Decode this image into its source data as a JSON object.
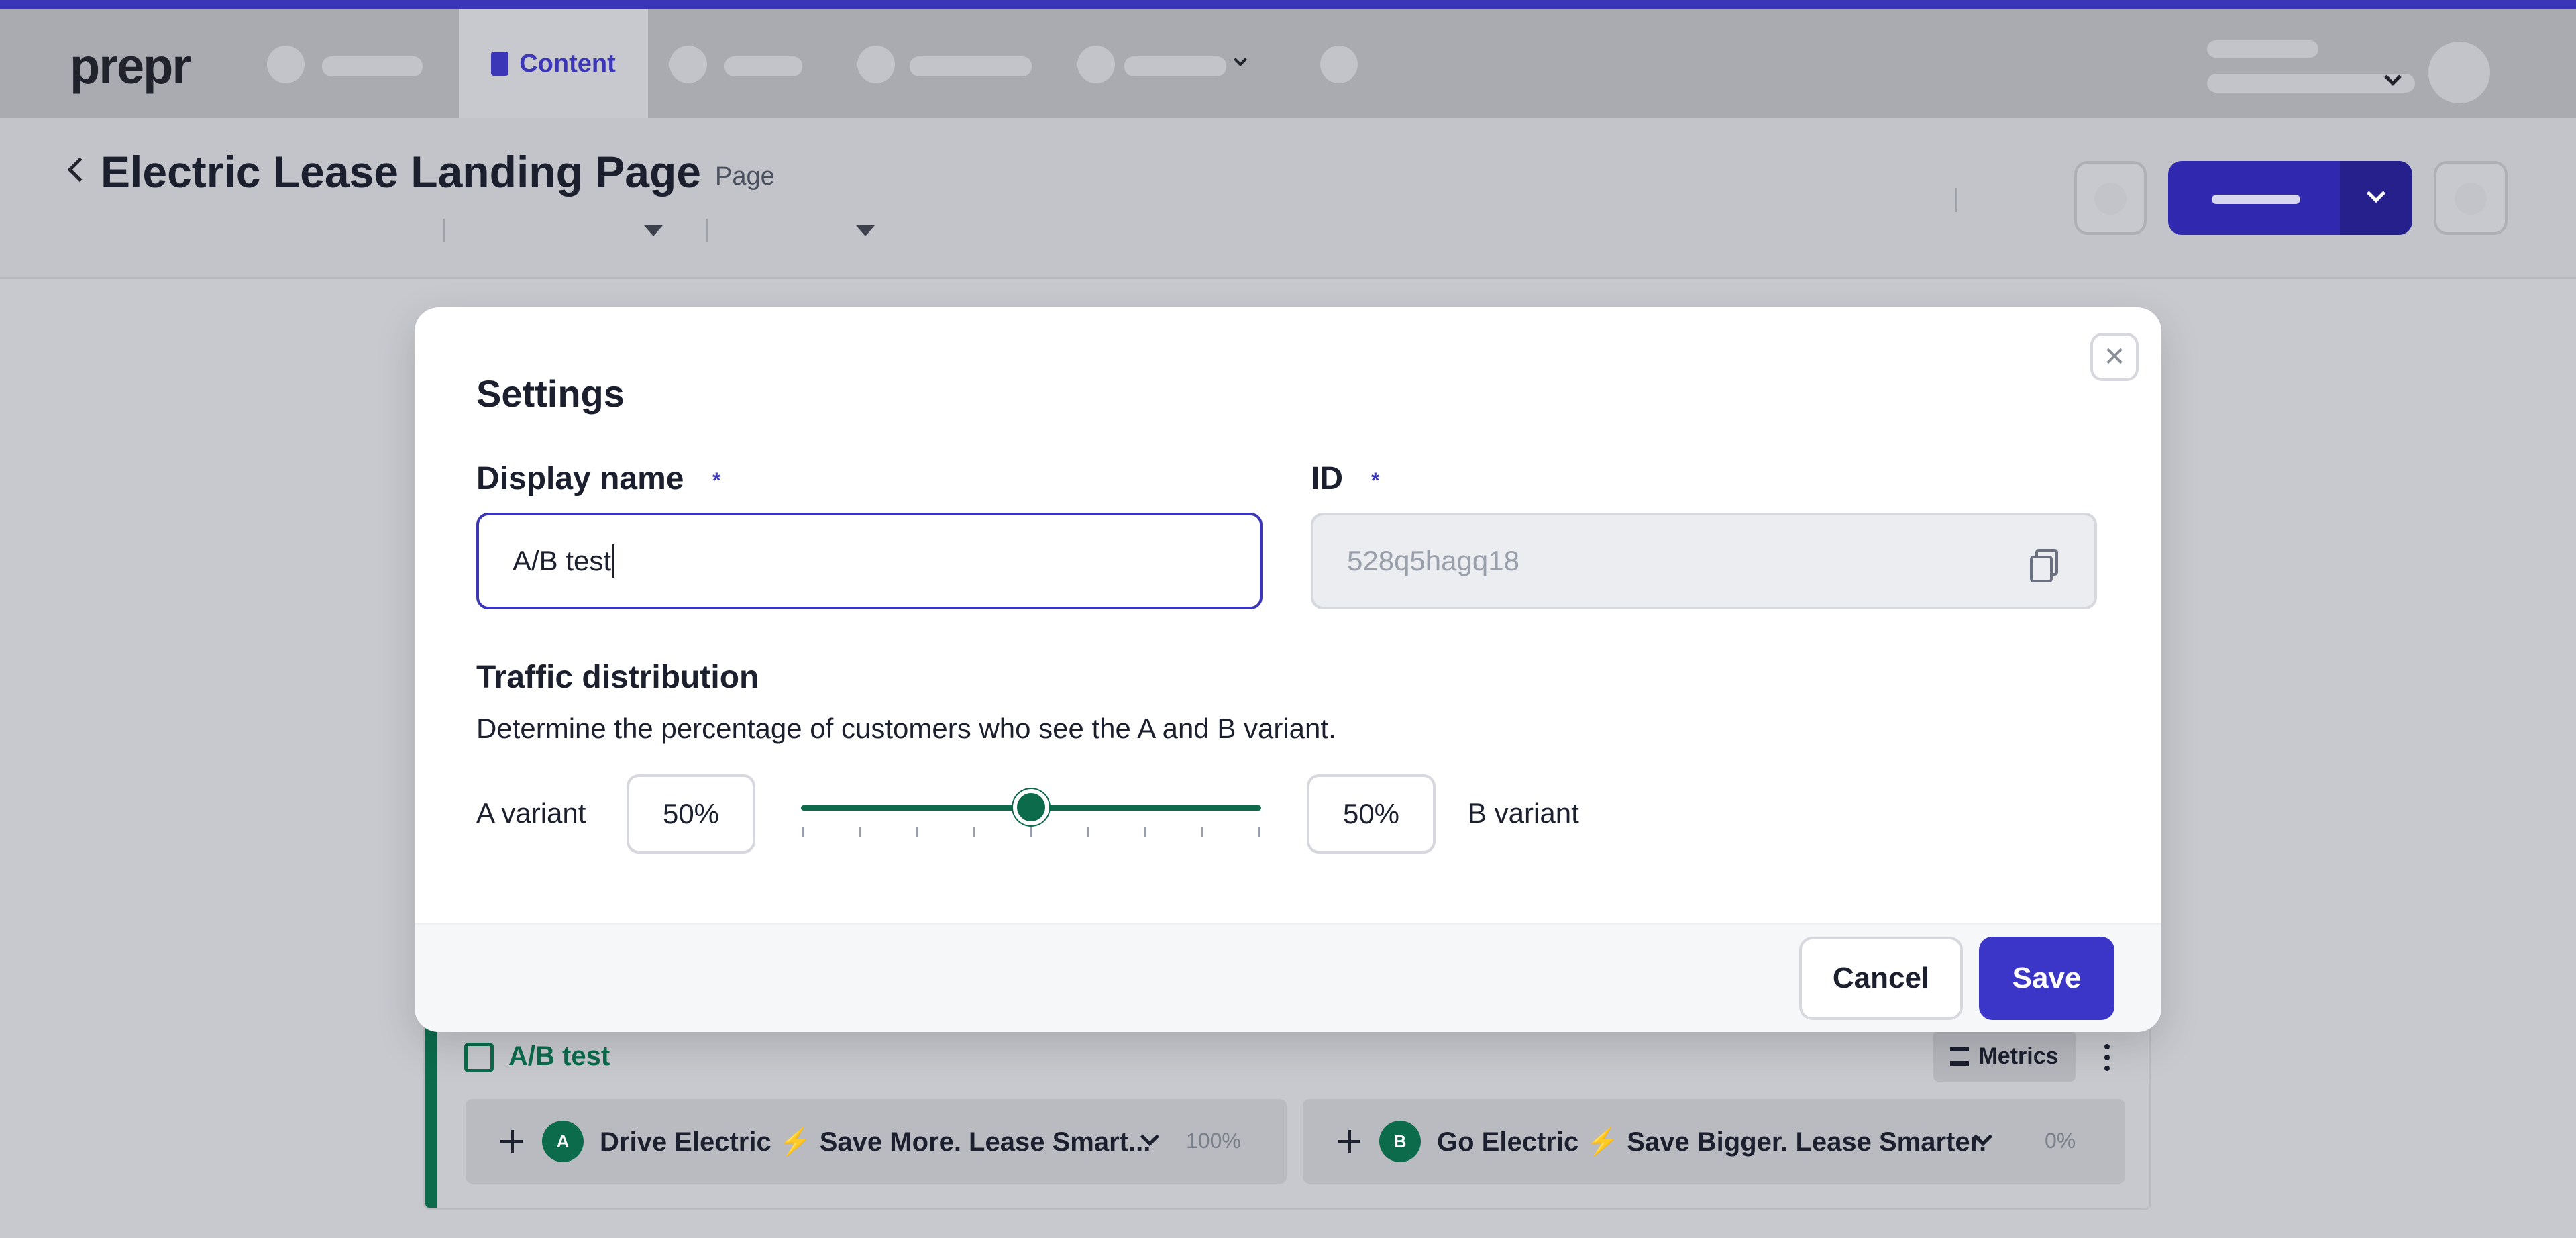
{
  "app": {
    "logo": "prepr"
  },
  "nav": {
    "active_tab": "Content"
  },
  "page": {
    "title": "Electric Lease Landing Page",
    "type_badge": "Page"
  },
  "colors": {
    "accent": "#3b35b8",
    "success": "#0b6b4b"
  },
  "background_card": {
    "ab_label": "A/B test",
    "metrics_label": "Metrics",
    "variant_a": {
      "avatar": "A",
      "title": "Drive Electric ⚡ Save More. Lease Smart...",
      "percent": "100%"
    },
    "variant_b": {
      "avatar": "B",
      "title": "Go Electric ⚡ Save Bigger. Lease Smarter.",
      "percent": "0%"
    }
  },
  "modal": {
    "title": "Settings",
    "close_icon": "close-icon",
    "display_name": {
      "label": "Display name",
      "required_mark": "*",
      "value": "A/B test"
    },
    "id_field": {
      "label": "ID",
      "required_mark": "*",
      "value": "528q5hagq18",
      "copy_icon": "copy-icon"
    },
    "traffic": {
      "title": "Traffic distribution",
      "description": "Determine the percentage of customers who see the A and B variant.",
      "a_label": "A variant",
      "a_value": "50%",
      "b_value": "50%",
      "b_label": "B variant",
      "slider_value_percent": 50
    },
    "cancel_label": "Cancel",
    "save_label": "Save"
  }
}
